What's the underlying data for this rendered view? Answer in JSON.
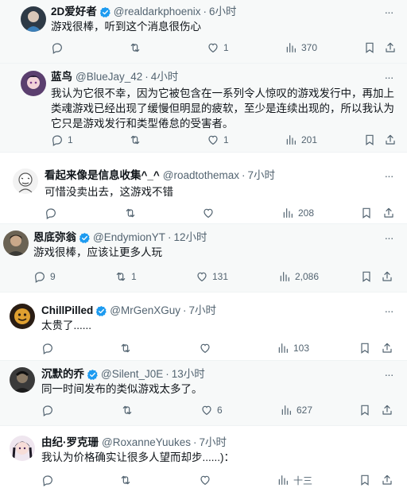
{
  "icons": {
    "reply": "reply-icon",
    "retweet": "retweet-icon",
    "like": "heart-icon",
    "views": "views-icon",
    "bookmark": "bookmark-icon",
    "share": "share-icon",
    "more": "more-icon",
    "verified": "verified-badge-icon"
  },
  "colors": {
    "verified": "#1d9bf0",
    "secondary_text": "#536471",
    "shaded_bg": "#f7f9f9"
  },
  "tweets": [
    {
      "name": "2D爱好者",
      "handle": "@realdarkphoenix",
      "dot": "·",
      "time": "6小时",
      "verified": true,
      "text": "游戏很棒，听到这个消息很伤心",
      "replies": "",
      "retweets": "",
      "likes": "1",
      "views": "370"
    },
    {
      "name": "蓝鸟",
      "handle": "@BlueJay_42",
      "dot": "·",
      "time": "4小时",
      "verified": false,
      "text": "我认为它很不幸，因为它被包含在一系列令人惊叹的游戏发行中，再加上类魂游戏已经出现了缓慢但明显的疲软，至少是连续出现的，所以我认为它只是游戏发行和类型倦怠的受害者。",
      "replies": "1",
      "retweets": "",
      "likes": "1",
      "views": "201"
    },
    {
      "name": "看起来像是信息收集^_^",
      "handle": "@roadtothemax",
      "dot": "·",
      "time": "7小时",
      "verified": false,
      "text": "可惜没卖出去，这游戏不错",
      "replies": "",
      "retweets": "",
      "likes": "",
      "views": "208"
    },
    {
      "name": "恩底弥翁",
      "handle": "@EndymionYT",
      "dot": "·",
      "time": "12小时",
      "verified": true,
      "text": "游戏很棒，应该让更多人玩",
      "replies": "9",
      "retweets": "1",
      "likes": "131",
      "views": "2,086"
    },
    {
      "name": "ChillPilled",
      "handle": "@MrGenXGuy",
      "dot": "·",
      "time": "7小时",
      "verified": true,
      "text": "太贵了......",
      "replies": "",
      "retweets": "",
      "likes": "",
      "views": "103"
    },
    {
      "name": "沉默的乔",
      "handle": "@Silent_J0E",
      "dot": "·",
      "time": "13小时",
      "verified": true,
      "text": "同一时间发布的类似游戏太多了。",
      "replies": "",
      "retweets": "",
      "likes": "6",
      "views": "627"
    },
    {
      "name": "由纪·罗克珊",
      "handle": "@RoxanneYuukes",
      "dot": "·",
      "time": "7小时",
      "verified": false,
      "text": "我认为价格确实让很多人望而却步......)：",
      "replies": "",
      "retweets": "",
      "likes": "",
      "views": "十三"
    }
  ]
}
